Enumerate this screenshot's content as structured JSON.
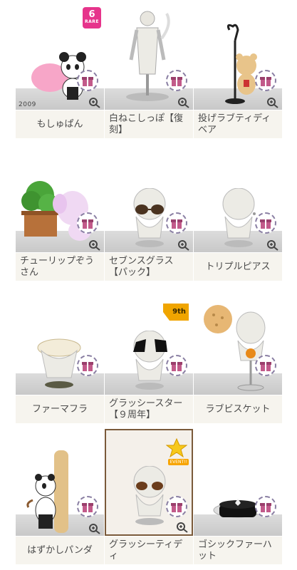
{
  "items": [
    {
      "name": "もしゅぱん",
      "year": "2009",
      "rare_number": "6",
      "rare_text": "RARE"
    },
    {
      "name": "白ねこしっぽ【復刻】"
    },
    {
      "name": "投げラブティディベア"
    },
    {
      "name": "チューリップぞうさん"
    },
    {
      "name": "セブンスグラス【パック】"
    },
    {
      "name": "トリプルピアス"
    },
    {
      "name": "ファーマフラ"
    },
    {
      "name": "グラッシースター【９周年】",
      "tag": "9th"
    },
    {
      "name": "ラブビスケット"
    },
    {
      "name": "はずかしパンダ"
    },
    {
      "name": "グラッシーティディ",
      "event": "EVENT!!"
    },
    {
      "name": "ゴシックファーハット"
    }
  ],
  "colors": {
    "label_bg": "#f6f4ee",
    "floor": "#d0d0d0",
    "gift_ring": "#8a7fa3",
    "rare_pink": "#e6348b",
    "tag_orange": "#f0a500"
  },
  "icons": {
    "gift": "gift-icon",
    "zoom": "zoom-in-icon"
  }
}
